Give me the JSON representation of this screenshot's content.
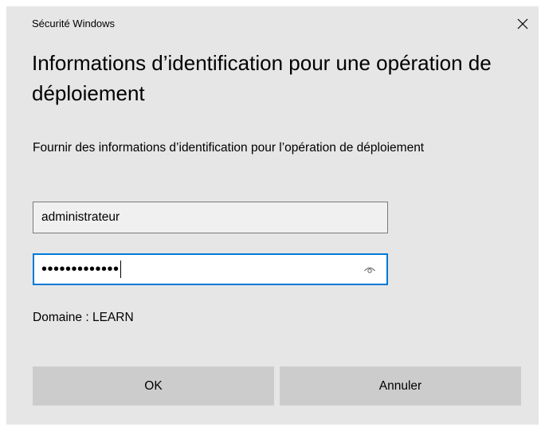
{
  "window": {
    "title": "Sécurité Windows",
    "close_icon": "close-icon"
  },
  "dialog": {
    "heading": "Informations d’identification pour une opération de déploiement",
    "description": "Fournir des informations d’identification pour l’opération de déploiement",
    "username": {
      "value": "administrateur"
    },
    "password": {
      "masked_value": "•••••••••••••",
      "reveal_icon": "eye-icon"
    },
    "domain_text": "Domaine : LEARN"
  },
  "buttons": {
    "ok_label": "OK",
    "cancel_label": "Annuler"
  },
  "colors": {
    "dialog_background": "#e6e6e6",
    "focus_border": "#0078d7",
    "button_background": "#cccccc"
  }
}
